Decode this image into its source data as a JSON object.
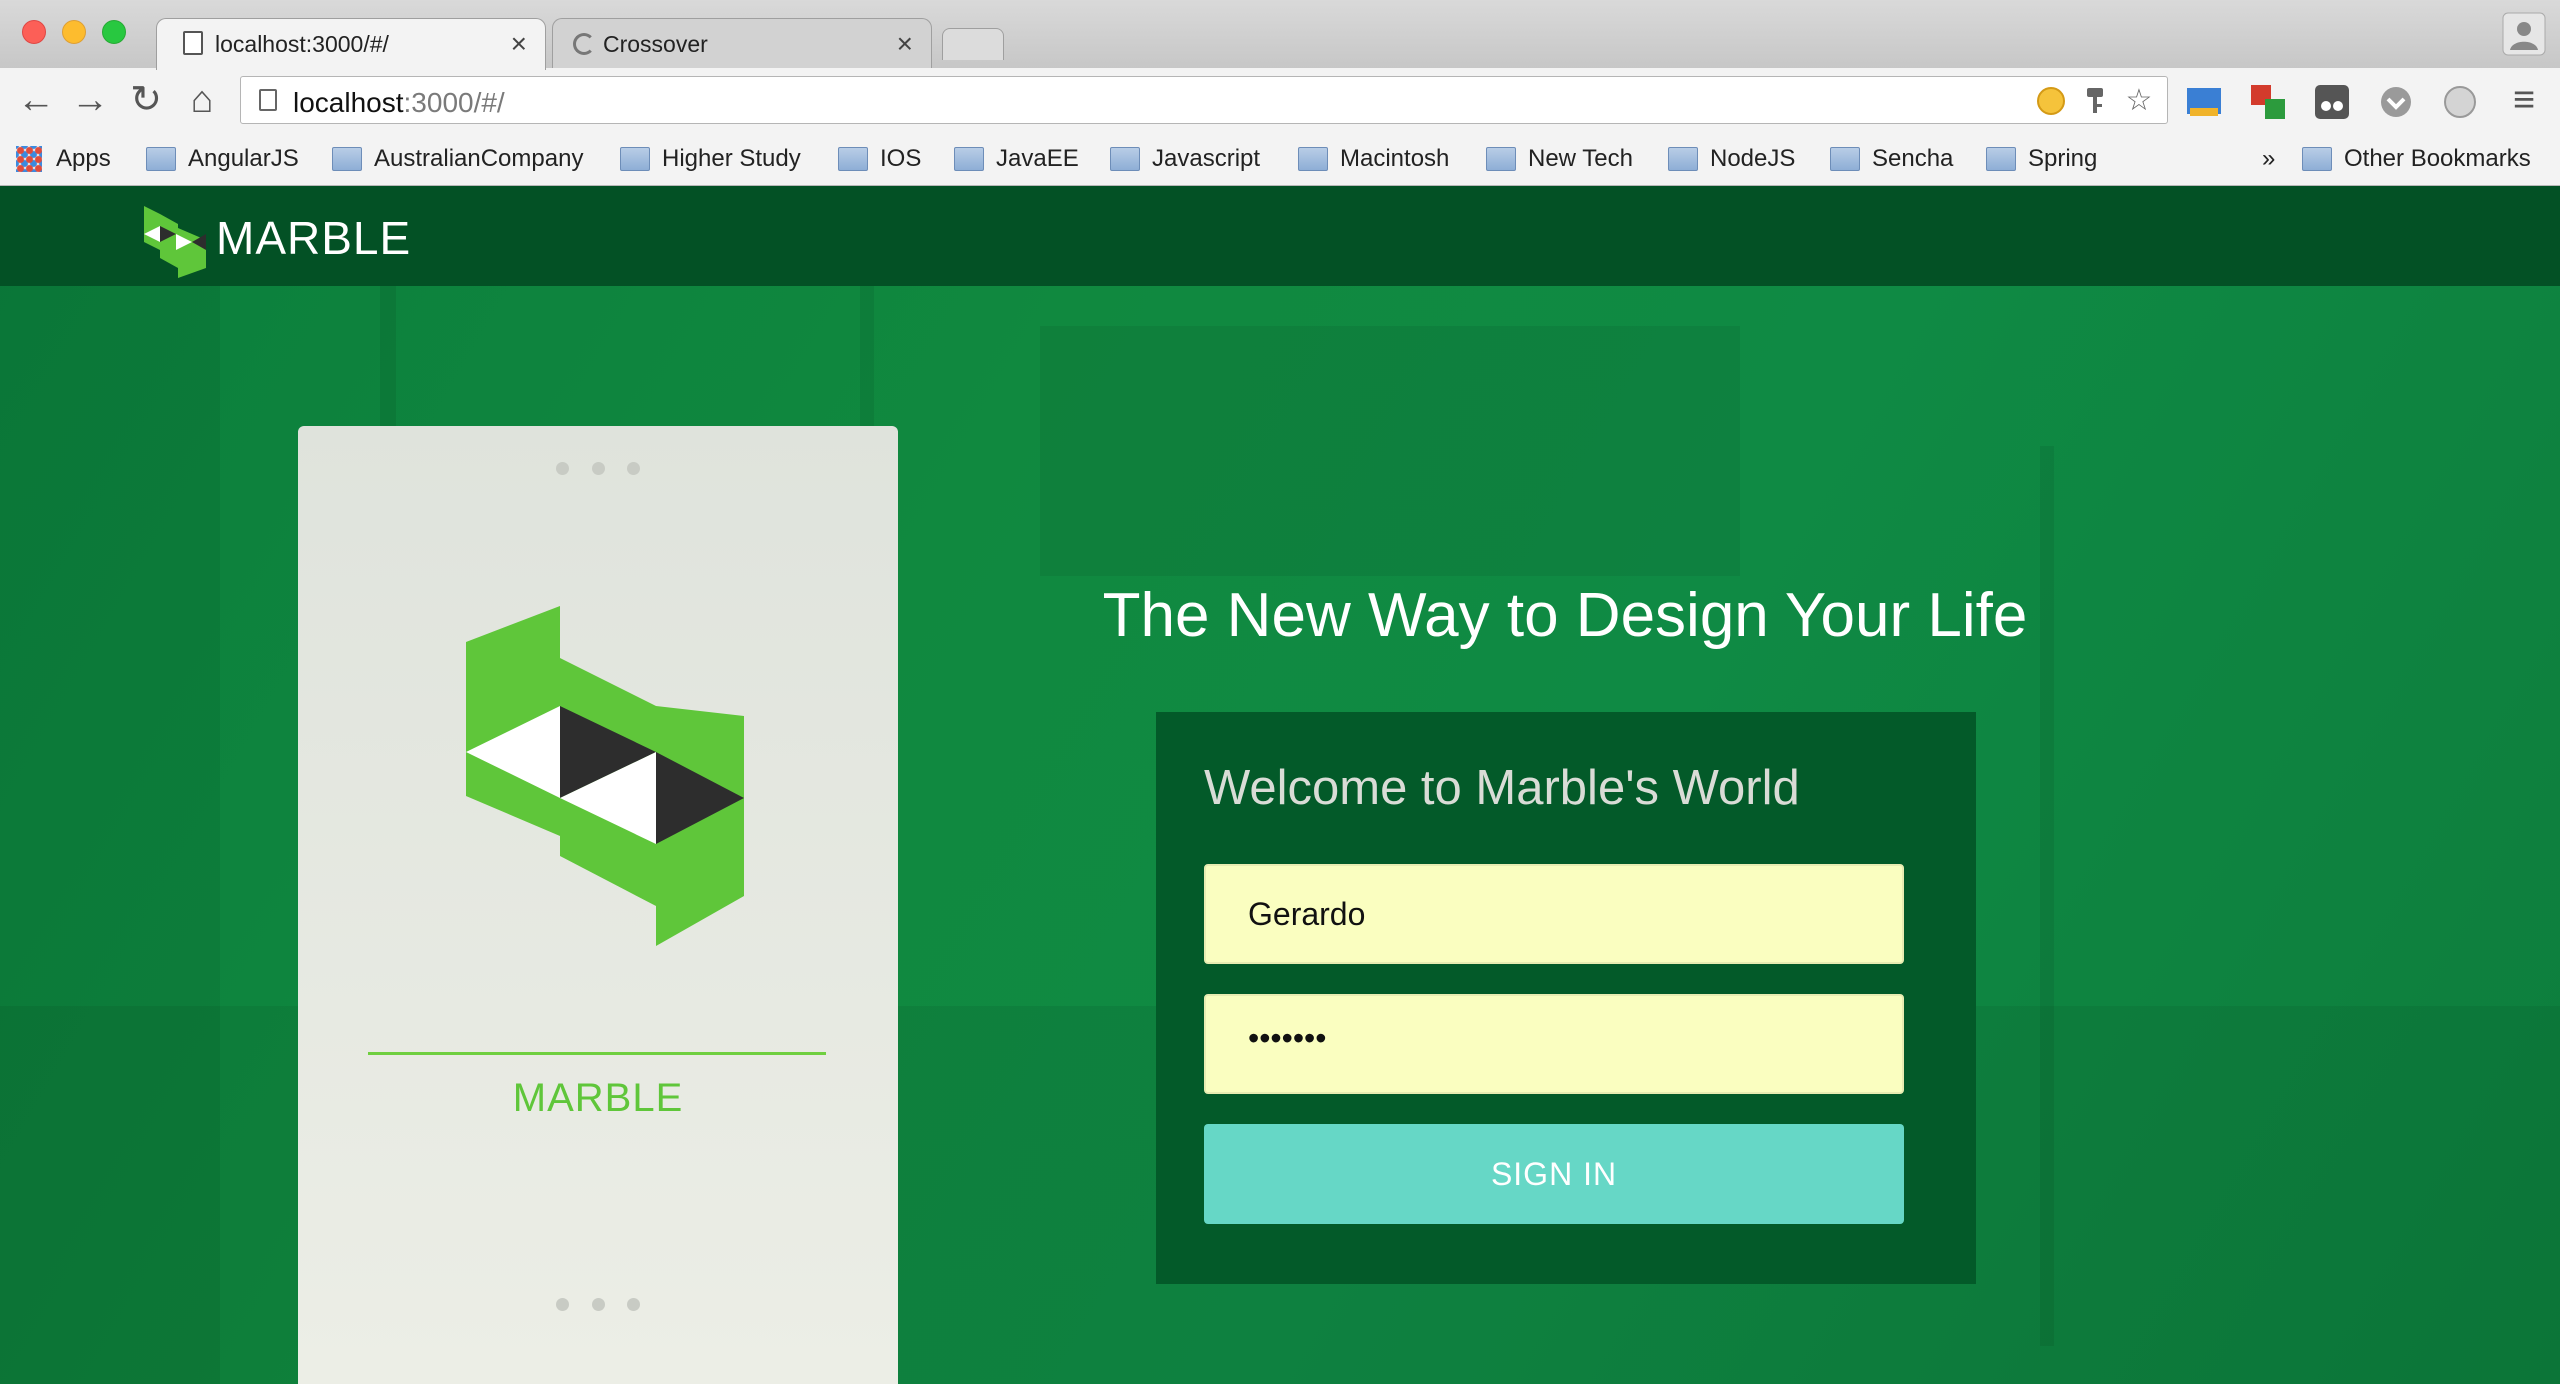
{
  "browser": {
    "tabs": [
      {
        "title": "localhost:3000/#/",
        "close": "×"
      },
      {
        "title": "Crossover",
        "close": "×"
      }
    ],
    "address": {
      "host": "localhost",
      "path": ":3000/#/"
    },
    "bookmarks": {
      "apps": "Apps",
      "folders": [
        "AngularJS",
        "AustralianCompany",
        "Higher Study",
        "IOS",
        "JavaEE",
        "Javascript",
        "Macintosh",
        "New Tech",
        "NodeJS",
        "Sencha",
        "Spring"
      ],
      "overflow": "»",
      "other": "Other Bookmarks"
    },
    "nav": {
      "back": "←",
      "forward": "→",
      "reload": "↻",
      "home": "⌂",
      "star": "☆",
      "menu": "≡"
    }
  },
  "header": {
    "brand": "MARBLE"
  },
  "card": {
    "name": "MARBLE"
  },
  "hero": {
    "tagline": "The New Way to Design Your Life"
  },
  "login": {
    "title": "Welcome to Marble's World",
    "username": "Gerardo",
    "password_mask": "•••••••",
    "signin_label": "SIGN IN"
  },
  "colors": {
    "header": "#035125",
    "page_green": "#0f8a44",
    "login_panel": "#035a29",
    "input_bg": "#fafec0",
    "button": "#66d7c6",
    "logo_green": "#5fc63a"
  }
}
